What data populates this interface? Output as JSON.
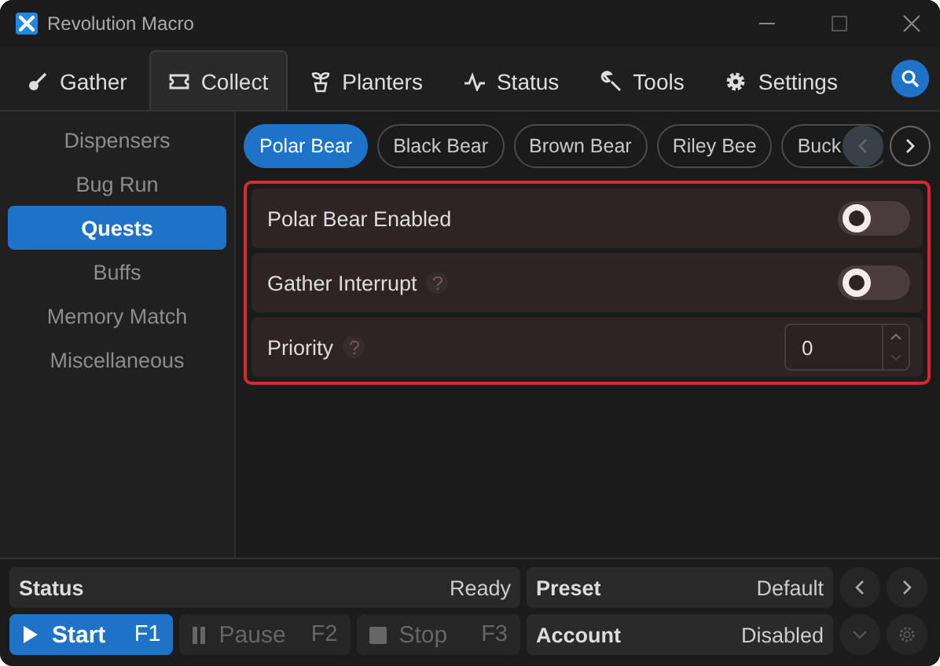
{
  "window": {
    "title": "Revolution Macro"
  },
  "tabs": [
    {
      "label": "Gather",
      "kind": "gather",
      "selected": false
    },
    {
      "label": "Collect",
      "kind": "collect",
      "selected": true
    },
    {
      "label": "Planters",
      "kind": "planters",
      "selected": false
    },
    {
      "label": "Status",
      "kind": "status",
      "selected": false
    },
    {
      "label": "Tools",
      "kind": "tools",
      "selected": false
    },
    {
      "label": "Settings",
      "kind": "settings",
      "selected": false
    }
  ],
  "sidebar": {
    "items": [
      {
        "label": "Dispensers",
        "selected": false
      },
      {
        "label": "Bug Run",
        "selected": false
      },
      {
        "label": "Quests",
        "selected": true
      },
      {
        "label": "Buffs",
        "selected": false
      },
      {
        "label": "Memory Match",
        "selected": false
      },
      {
        "label": "Miscellaneous",
        "selected": false
      }
    ]
  },
  "chips": [
    {
      "label": "Polar Bear",
      "selected": true
    },
    {
      "label": "Black Bear",
      "selected": false
    },
    {
      "label": "Brown Bear",
      "selected": false
    },
    {
      "label": "Riley Bee",
      "selected": false
    },
    {
      "label": "Buck",
      "selected": false
    }
  ],
  "chip_scroll": {
    "prev_disabled": true,
    "next_disabled": false
  },
  "settings": {
    "highlighted": true,
    "rows": [
      {
        "kind": "toggle",
        "label": "Polar Bear Enabled",
        "help": false,
        "on": false
      },
      {
        "kind": "toggle",
        "label": "Gather Interrupt",
        "help": true,
        "on": false
      },
      {
        "kind": "number",
        "label": "Priority",
        "help": true,
        "value": "0"
      }
    ]
  },
  "status": {
    "label": "Status",
    "value": "Ready"
  },
  "preset": {
    "label": "Preset",
    "value": "Default"
  },
  "account": {
    "label": "Account",
    "value": "Disabled"
  },
  "controls": [
    {
      "kind": "start",
      "label": "Start",
      "key": "F1",
      "disabled": false
    },
    {
      "kind": "pause",
      "label": "Pause",
      "key": "F2",
      "disabled": true
    },
    {
      "kind": "stop",
      "label": "Stop",
      "key": "F3",
      "disabled": true
    }
  ]
}
